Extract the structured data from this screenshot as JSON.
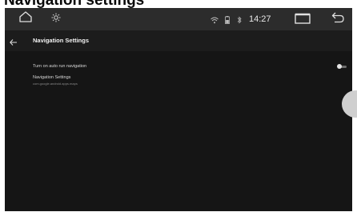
{
  "caption": "Navigation settings",
  "status_bar": {
    "time": "14:27",
    "icons": [
      "home-icon",
      "brightness-icon",
      "wifi-icon",
      "battery-icon",
      "bluetooth-icon",
      "recent-apps-icon",
      "back-icon"
    ]
  },
  "toolbar": {
    "title": "Navigation Settings",
    "back_icon": "back-arrow-icon"
  },
  "settings": {
    "auto_run": {
      "label": "Turn on auto run navigation",
      "enabled": false
    },
    "navigation_app": {
      "label": "Navigation Settings",
      "value": "com.google.android.apps.maps"
    }
  },
  "colors": {
    "screen_bg": "#151515",
    "status_bar_bg": "#2c2c2c",
    "toolbar_bg": "#1c1c1c",
    "text_primary": "#f0f0f0",
    "text_secondary": "#8a8a8a"
  }
}
